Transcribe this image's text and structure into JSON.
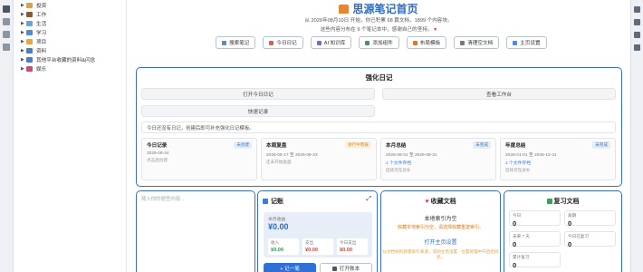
{
  "colors": {
    "accent": "#2b6cc4",
    "border": "#3c6fb5",
    "primary_button": "#2f6fd6",
    "warning": "#e07a1e"
  },
  "tree": {
    "items": [
      {
        "label": "投资",
        "icon": "money-bag-icon",
        "color": "#d9a441"
      },
      {
        "label": "工作",
        "icon": "briefcase-icon",
        "color": "#8a5a35"
      },
      {
        "label": "生活",
        "icon": "house-icon",
        "color": "#6aa3d8"
      },
      {
        "label": "学习",
        "icon": "books-icon",
        "color": "#4f8bd6"
      },
      {
        "label": "项目",
        "icon": "folder-icon",
        "color": "#e6a93a"
      },
      {
        "label": "资料",
        "icon": "archive-icon",
        "color": "#4a7fbf"
      },
      {
        "label": "其他平台收藏的资料&闪念",
        "icon": "archive-icon",
        "color": "#4a7fbf"
      },
      {
        "label": "娱乐",
        "icon": "game-icon",
        "color": "#d04a6b"
      }
    ]
  },
  "header": {
    "title": "思源笔记首页",
    "subtitle1": "从 2026年08月10日 开始，你已积累 68 篇文档，1899 个内容块。",
    "subtitle2": "这些内容分布在 9 个笔记本中，感谢自己的坚持。"
  },
  "buttons": [
    {
      "label": "搜索笔记",
      "icon": "search-icon",
      "color": "#4f8bd6"
    },
    {
      "label": "今日日记",
      "icon": "calendar-icon",
      "color": "#e55a4a"
    },
    {
      "label": "AI 知识库",
      "icon": "ai-icon",
      "color": "#6a6fd6"
    },
    {
      "label": "添加组件",
      "icon": "plus-icon",
      "color": "#3f9a5c"
    },
    {
      "label": "布局模板",
      "icon": "layout-icon",
      "color": "#e07a1e"
    },
    {
      "label": "清理空文档",
      "icon": "trash-icon",
      "color": "#777777"
    },
    {
      "label": "主页设置",
      "icon": "gear-icon",
      "color": "#4f8bd6"
    }
  ],
  "diary": {
    "title": "强化日记",
    "open_today": "打开今日日记",
    "view_workbench": "查看工作台",
    "quick_record": "快速记录",
    "tip": "今日还没有日记，创建后即可补充强化日记模板。",
    "cards": [
      {
        "title": "今日记录",
        "tag": "未创建",
        "tag_class": "blue",
        "date": "2026-08-24",
        "link": "",
        "gray": "点击后创建"
      },
      {
        "title": "本周复盘",
        "tag": "进行中周报",
        "tag_class": "orange",
        "date": "2026-08-17 至 2026-08-23",
        "link": "",
        "gray": "还未开始复盘"
      },
      {
        "title": "本月总结",
        "tag": "未完成",
        "tag_class": "blue",
        "date": "2026-08-01 至 2026-08-31",
        "link": "1 个文件存档",
        "gray": "后续可在此补"
      },
      {
        "title": "年度总结",
        "tag": "未完成",
        "tag_class": "blue",
        "date": "2026-01-01 至 2026-12-31",
        "link": "1 个文件存档",
        "gray": "后续可在此补"
      }
    ]
  },
  "note": {
    "placeholder": "随入你的便签内容..."
  },
  "ledger": {
    "title": "记账",
    "month_label": "本月收益",
    "month_value": "¥0.00",
    "income_label": "收入",
    "income_value": "¥0.00",
    "expense_label": "支出",
    "expense_value": "¥0.00",
    "today_label": "今日支出",
    "today_value": "¥0.00",
    "add_label": "+ 记一笔",
    "open_label": "打开账本"
  },
  "favorites": {
    "title": "收藏文档",
    "empty": "本地索引为空",
    "hint": "收藏本地索引为空，请选择收藏重建索引。",
    "open_settings": "打开主页设置",
    "note": "从文档树的新建索引来源，或到主页设置 - 位置管理中开启后同步。"
  },
  "review": {
    "title": "复习文档",
    "stats": [
      {
        "label": "今日",
        "value": "0"
      },
      {
        "label": "逾期",
        "value": "0"
      },
      {
        "label": "未来 7 天",
        "value": "0"
      },
      {
        "label": "今日已复习",
        "value": "0"
      },
      {
        "label": "累计复习",
        "value": "0"
      }
    ]
  }
}
